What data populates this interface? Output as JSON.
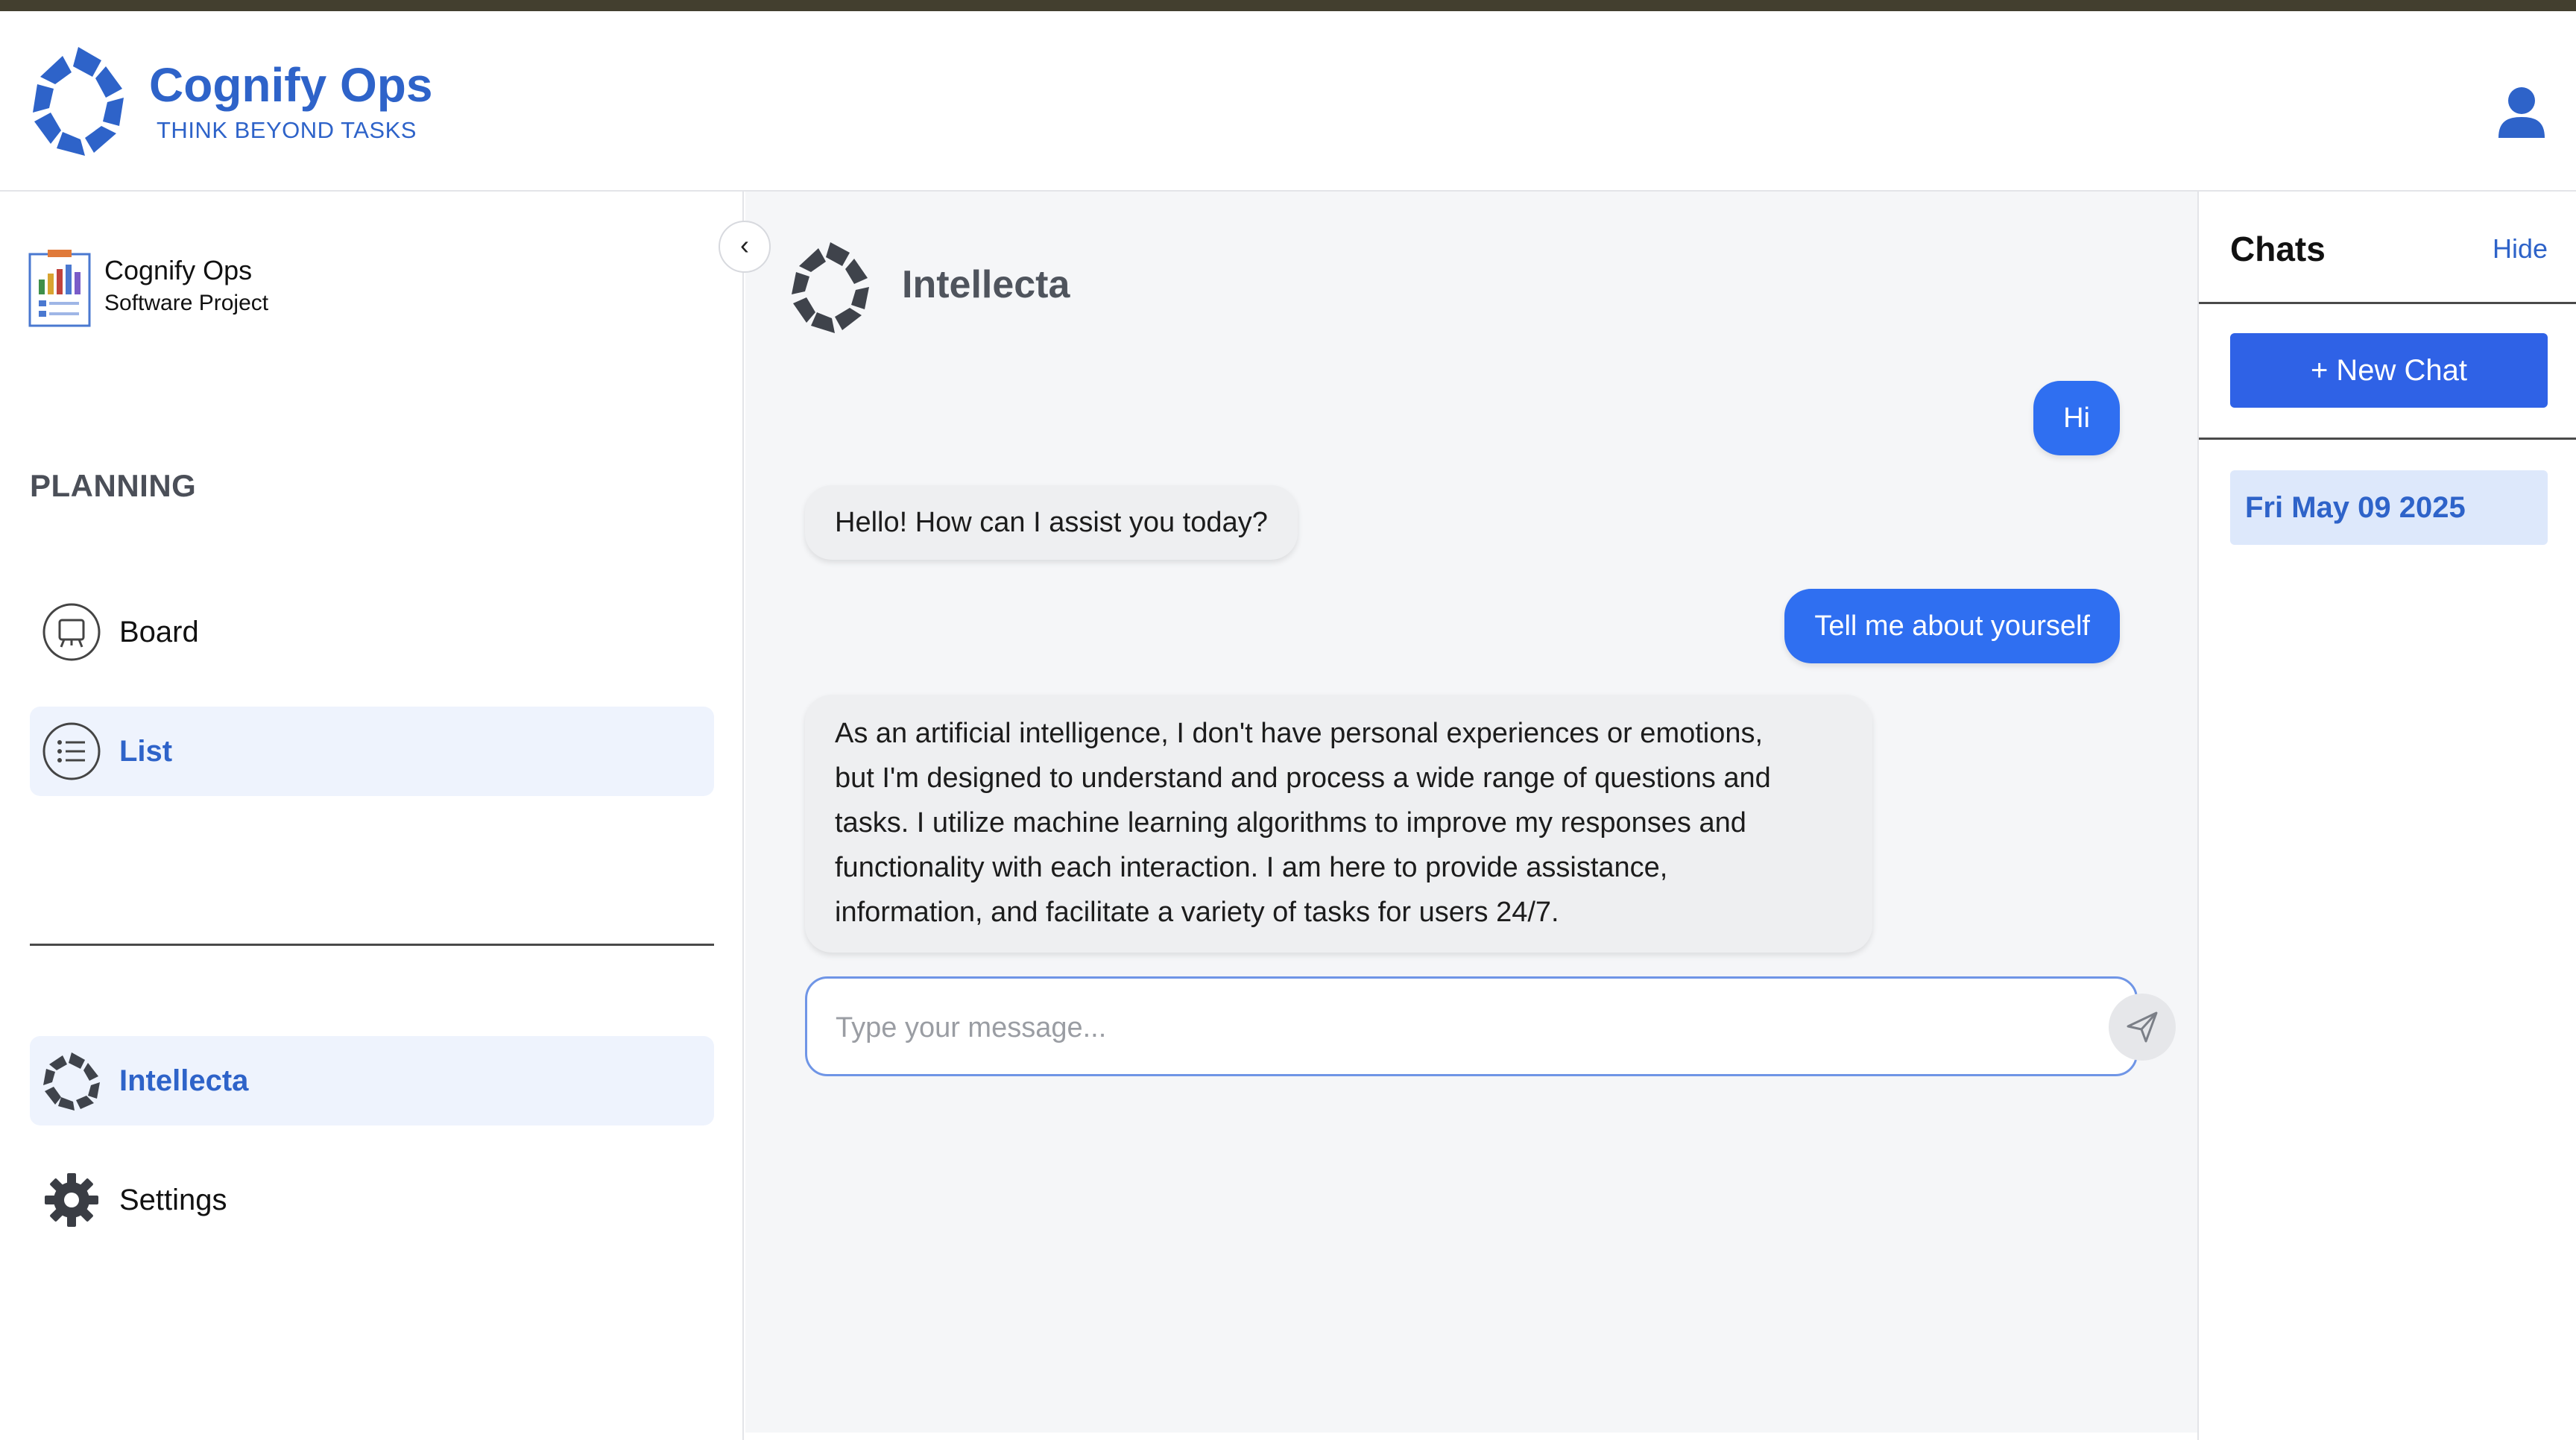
{
  "header": {
    "brand_name": "Cognify Ops",
    "tagline": "THINK BEYOND TASKS",
    "logo_icon": "brand-logo-icon",
    "user_icon": "user-icon"
  },
  "sidebar": {
    "project": {
      "name": "Cognify Ops",
      "type": "Software Project"
    },
    "section_title": "PLANNING",
    "planning_items": [
      {
        "label": "Board",
        "icon": "board-icon",
        "active": false
      },
      {
        "label": "List",
        "icon": "list-icon",
        "active": true
      }
    ],
    "bottom_items": [
      {
        "label": "Intellecta",
        "icon": "intellecta-icon",
        "active": true
      },
      {
        "label": "Settings",
        "icon": "gear-icon",
        "active": false
      }
    ],
    "collapse_label": "‹"
  },
  "chat": {
    "title": "Intellecta",
    "messages": [
      {
        "role": "user",
        "text": "Hi"
      },
      {
        "role": "bot",
        "text": "Hello! How can I assist you today?"
      },
      {
        "role": "user",
        "text": "Tell me about yourself"
      },
      {
        "role": "bot",
        "lines": [
          "As an artificial intelligence, I don't have personal experiences or emotions,",
          "but I'm designed to understand and process a wide range of questions and",
          "tasks. I utilize machine learning algorithms to improve my responses and",
          "functionality with each interaction. I am here to provide assistance,",
          "information, and facilitate a variety of tasks for users 24/7."
        ]
      }
    ],
    "input": {
      "placeholder": "Type your message...",
      "value": ""
    }
  },
  "chats_panel": {
    "title": "Chats",
    "hide_label": "Hide",
    "new_chat_label": "+ New Chat",
    "history": [
      {
        "label": "Fri May 09 2025"
      }
    ]
  },
  "colors": {
    "brand": "#2e63c9",
    "user_bubble": "#2f6ff1",
    "new_chat_button": "#2f62e6",
    "active_nav_bg": "#eef3fd"
  }
}
